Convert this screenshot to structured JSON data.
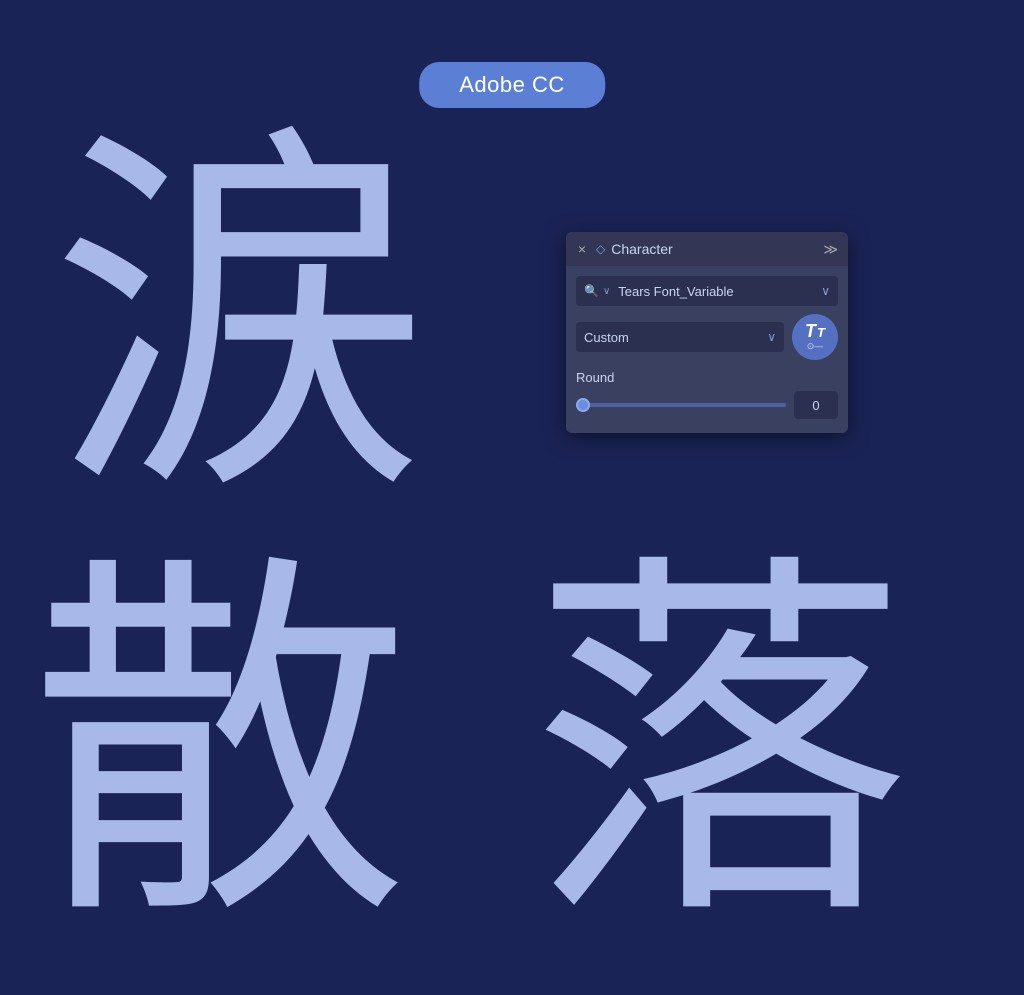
{
  "badge": {
    "label": "Adobe CC"
  },
  "canvas": {
    "chars": {
      "tears": "涙",
      "scatter": "散",
      "fall": "落"
    }
  },
  "panel": {
    "close_icon": "×",
    "collapse_icon": "≫",
    "chevron_label": "◇",
    "title": "Character",
    "font_search_icon": "🔍",
    "font_search_chevron": "∨",
    "font_name": "Tears Font_Variable",
    "font_dropdown_arrow": "∨",
    "style_name": "Custom",
    "style_dropdown_arrow": "∨",
    "tt_big": "T",
    "tt_small": "T",
    "tt_sliders": "⊙—",
    "round_label": "Round",
    "round_value": "0",
    "slider_min": 0,
    "slider_max": 100,
    "slider_value": 0
  }
}
